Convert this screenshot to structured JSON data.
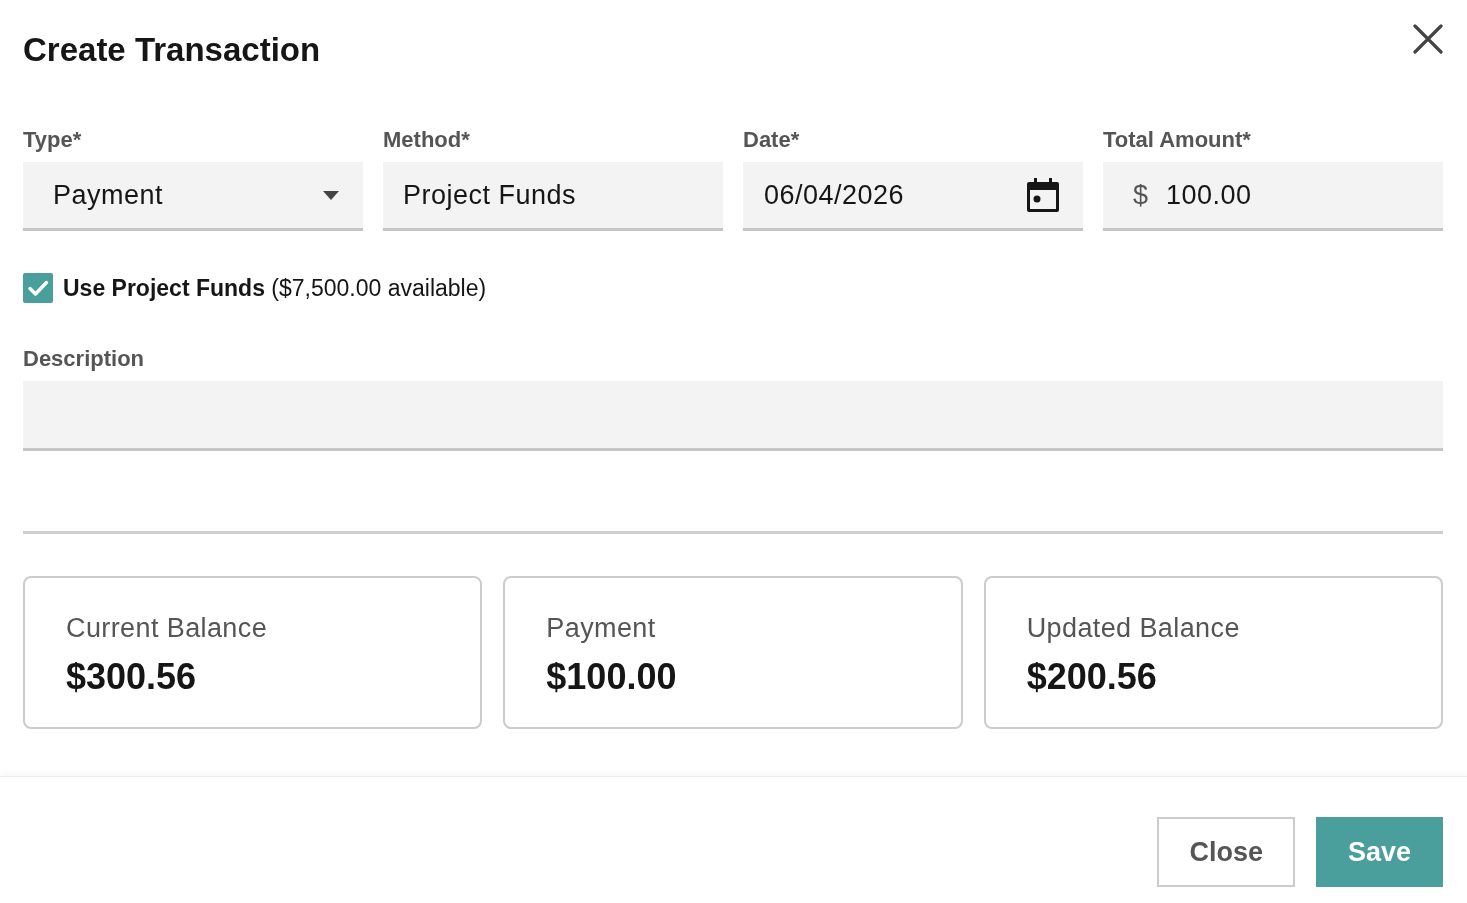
{
  "dialog": {
    "title": "Create Transaction"
  },
  "fields": [
    {
      "kind": "select",
      "label": "Type*",
      "value": "Payment"
    },
    {
      "kind": "text",
      "label": "Method*",
      "value": "Project Funds"
    },
    {
      "kind": "date",
      "label": "Date*",
      "value": "06/04/2026"
    },
    {
      "kind": "currency",
      "label": "Total Amount*",
      "prefix": "$",
      "value": "100.00"
    }
  ],
  "use_project_funds": {
    "checked": true,
    "label": "**Use Project Funds** ($7,500.00 available)"
  },
  "description": {
    "label": "Description"
  },
  "summary_cards": [
    {
      "label": "Current Balance",
      "value": "$300.56"
    },
    {
      "label": "Payment",
      "value": "$100.00"
    },
    {
      "label": "Updated Balance",
      "value": "$200.56"
    }
  ],
  "buttons": [
    {
      "kind": "secondary",
      "label": "Close"
    },
    {
      "kind": "primary",
      "label": "Save"
    }
  ]
}
